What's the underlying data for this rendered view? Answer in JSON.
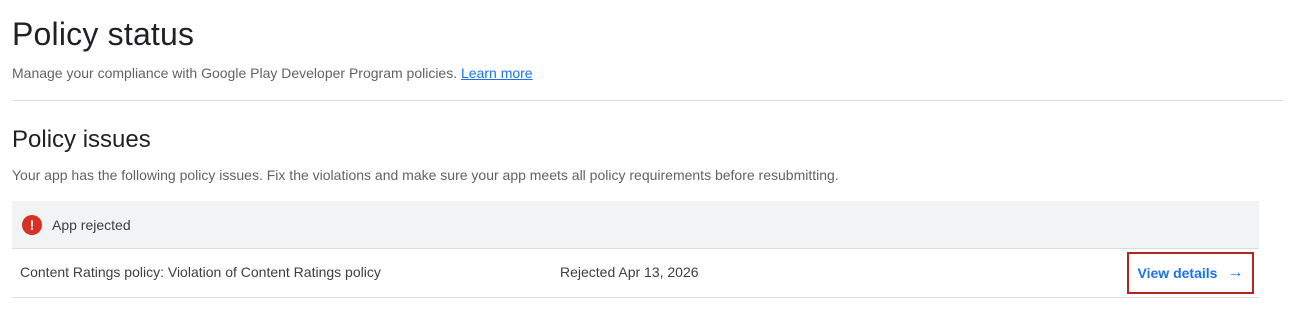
{
  "header": {
    "title": "Policy status",
    "subtitle": "Manage your compliance with Google Play Developer Program policies.",
    "learn_more": "Learn more"
  },
  "section": {
    "title": "Policy issues",
    "description": "Your app has the following policy issues. Fix the violations and make sure your app meets all policy requirements before resubmitting."
  },
  "issues": {
    "status_icon": "error-icon",
    "status_label": "App rejected",
    "status_color": "#d93025",
    "rows": [
      {
        "policy": "Content Ratings policy: Violation of Content Ratings policy",
        "status": "Rejected Apr 13, 2026",
        "action_label": "View details",
        "action_icon": "arrow-right-icon"
      }
    ]
  },
  "colors": {
    "link": "#1a73e8",
    "highlight_border": "#b3261e",
    "header_bg": "#f1f3f4"
  }
}
